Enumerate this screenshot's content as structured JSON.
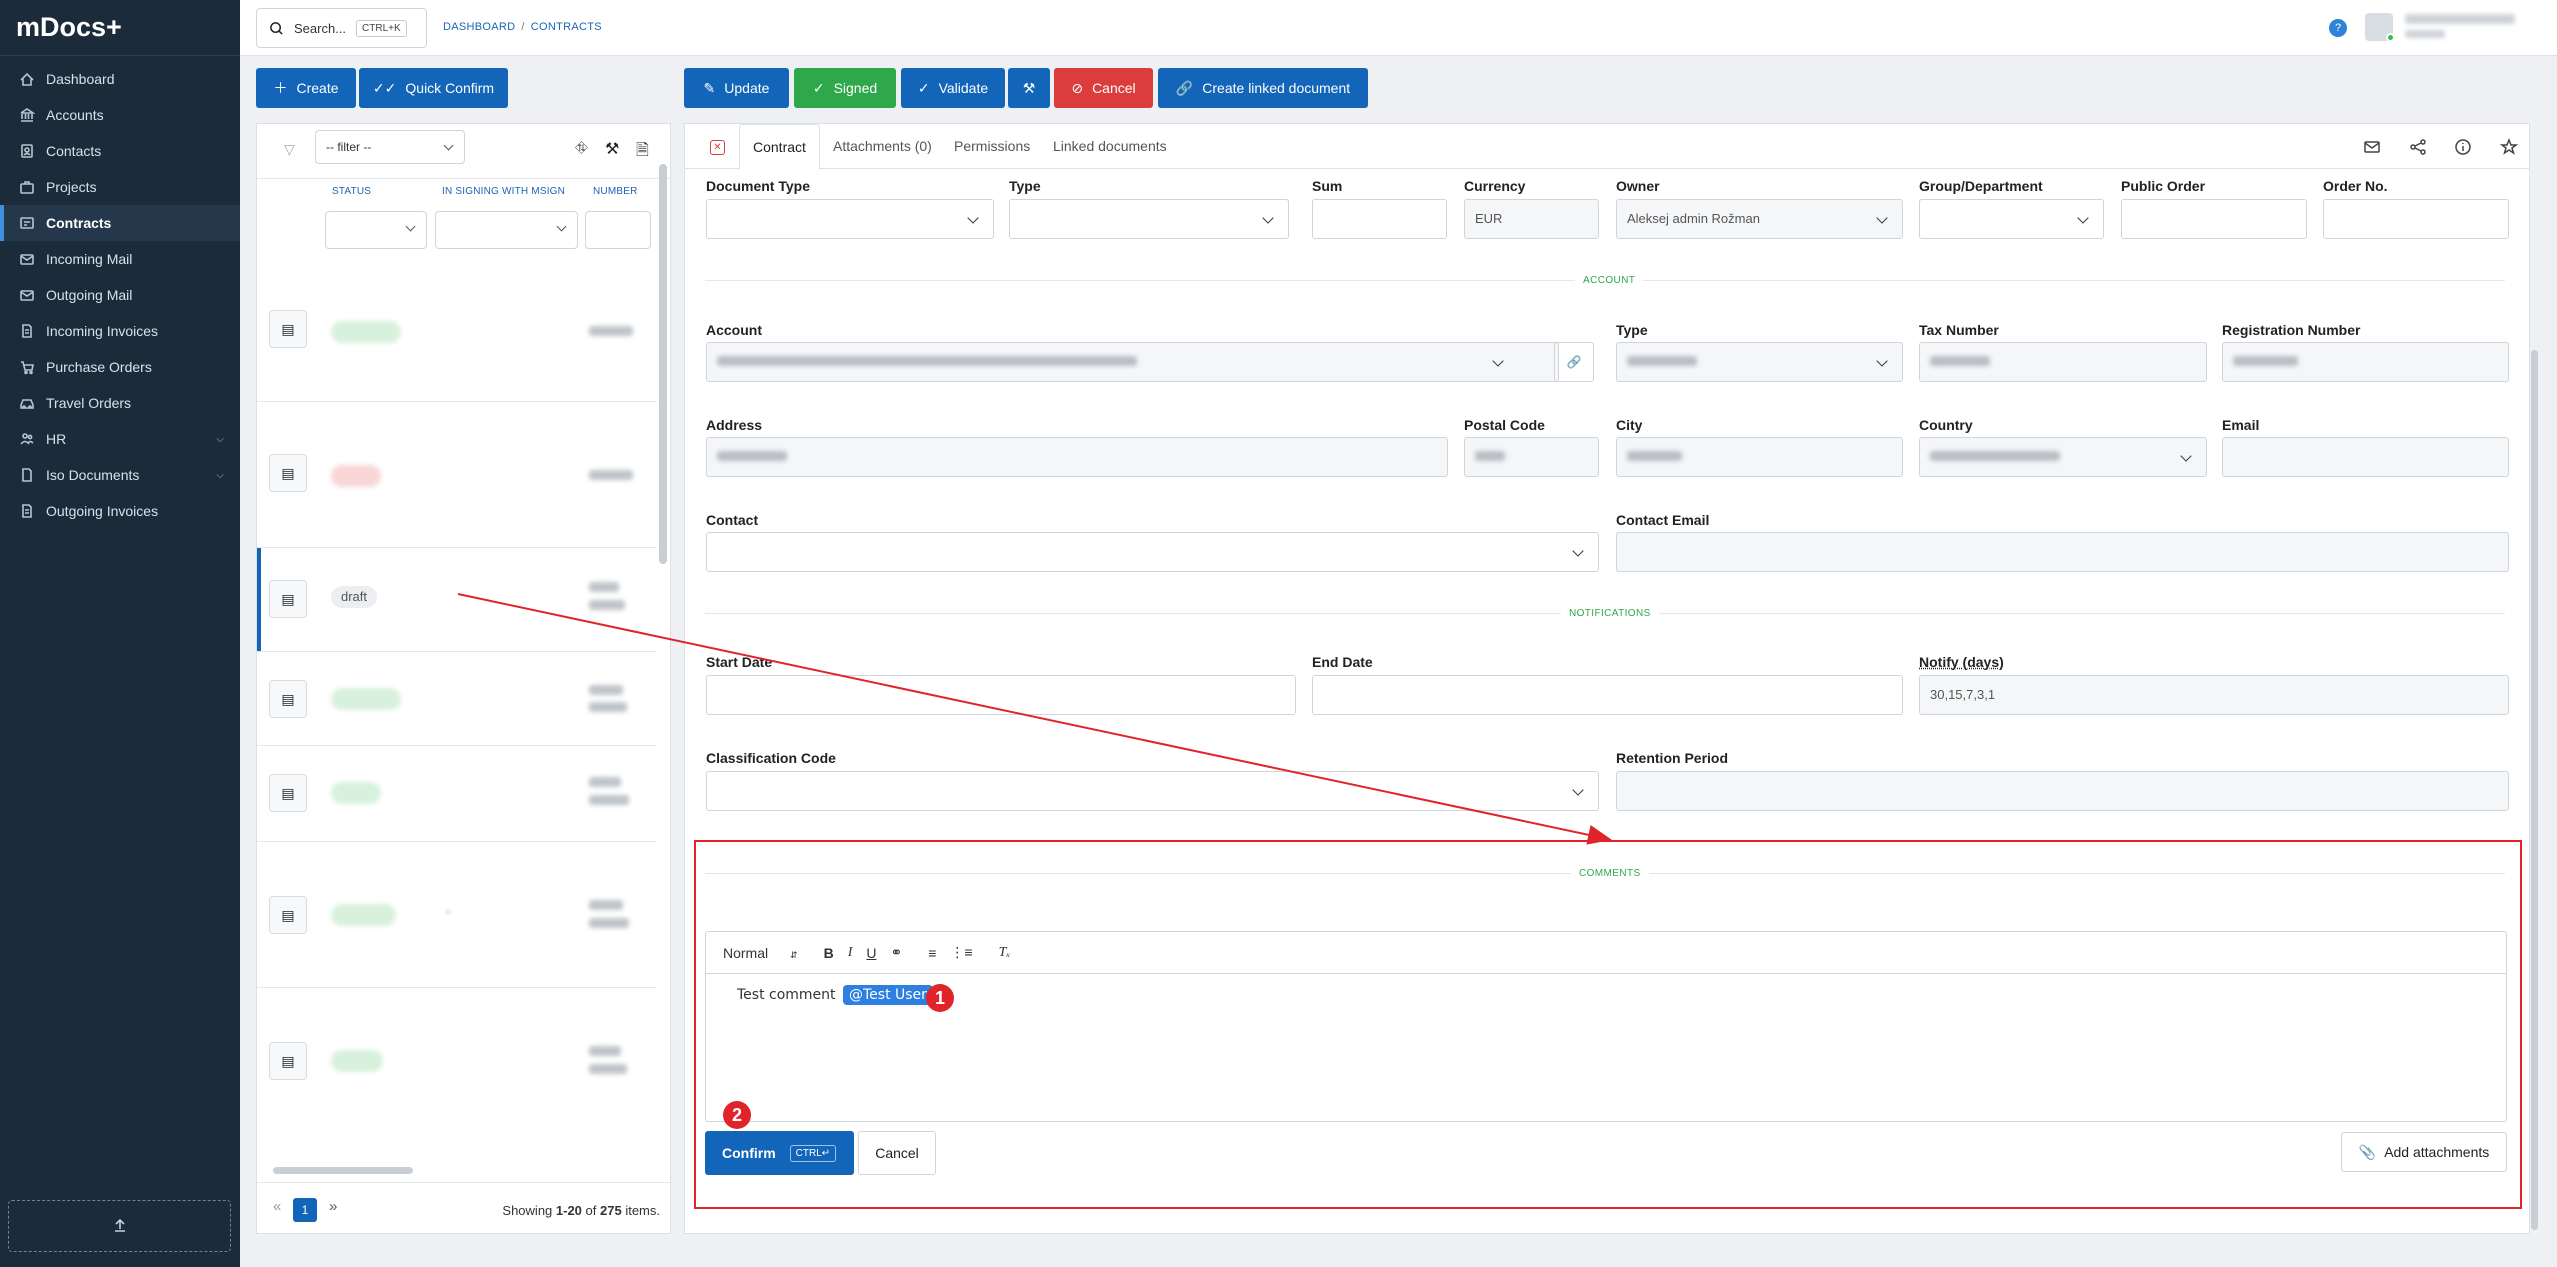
{
  "app": {
    "brand": "mDocs+"
  },
  "sidebar": {
    "items": [
      {
        "label": "Dashboard",
        "icon": "dashboard-icon"
      },
      {
        "label": "Accounts",
        "icon": "bank-icon"
      },
      {
        "label": "Contacts",
        "icon": "contacts-icon"
      },
      {
        "label": "Projects",
        "icon": "briefcase-icon"
      },
      {
        "label": "Contracts",
        "icon": "contract-icon",
        "active": true
      },
      {
        "label": "Incoming Mail",
        "icon": "mail-icon"
      },
      {
        "label": "Outgoing Mail",
        "icon": "mail-icon"
      },
      {
        "label": "Incoming Invoices",
        "icon": "invoice-icon"
      },
      {
        "label": "Purchase Orders",
        "icon": "cart-icon"
      },
      {
        "label": "Travel Orders",
        "icon": "car-icon"
      },
      {
        "label": "HR",
        "icon": "people-icon",
        "expandable": true
      },
      {
        "label": "Iso Documents",
        "icon": "document-icon",
        "expandable": true
      },
      {
        "label": "Outgoing Invoices",
        "icon": "invoice-icon"
      }
    ]
  },
  "topbar": {
    "search_label": "Search...",
    "search_shortcut": "CTRL+K",
    "breadcrumb": [
      "DASHBOARD",
      "CONTRACTS"
    ],
    "breadcrumb_sep": "/",
    "help": "?"
  },
  "actions_left": {
    "create": "Create",
    "quick_confirm": "Quick Confirm"
  },
  "actions_right": {
    "update": "Update",
    "signed": "Signed",
    "validate": "Validate",
    "cancel": "Cancel",
    "create_linked": "Create linked document"
  },
  "list": {
    "filter_placeholder": "-- filter --",
    "columns": [
      "STATUS",
      "IN SIGNING WITH MSIGN",
      "NUMBER"
    ],
    "draft_label": "draft",
    "page": "1",
    "showing_prefix": "Showing ",
    "showing_range": "1-20",
    "showing_of": " of ",
    "showing_total": "275",
    "showing_suffix": " items."
  },
  "form": {
    "tabs": [
      "Contract",
      "Attachments (0)",
      "Permissions",
      "Linked documents"
    ],
    "labels": {
      "document_type": "Document Type",
      "type": "Type",
      "sum": "Sum",
      "currency": "Currency",
      "owner": "Owner",
      "group": "Group/Department",
      "public_order": "Public Order",
      "order_no": "Order No.",
      "account": "Account",
      "account_type": "Type",
      "tax_number": "Tax Number",
      "registration_number": "Registration Number",
      "address": "Address",
      "postal_code": "Postal Code",
      "city": "City",
      "country": "Country",
      "email": "Email",
      "contact": "Contact",
      "contact_email": "Contact Email",
      "start_date": "Start Date",
      "end_date": "End Date",
      "notify_days": "Notify (days)",
      "classification_code": "Classification Code",
      "retention_period": "Retention Period"
    },
    "values": {
      "currency": "EUR",
      "owner": "Aleksej admin Rožman",
      "notify_days": "30,15,7,3,1"
    },
    "sections": {
      "account": "ACCOUNT",
      "notifications": "NOTIFICATIONS",
      "comments": "COMMENTS"
    }
  },
  "comments": {
    "format": "Normal",
    "text": "Test comment",
    "mention": "@Test User",
    "marker1": "1",
    "marker2": "2",
    "confirm": "Confirm",
    "confirm_shortcut": "CTRL↵",
    "cancel": "Cancel",
    "add_attachments": "Add attachments"
  }
}
